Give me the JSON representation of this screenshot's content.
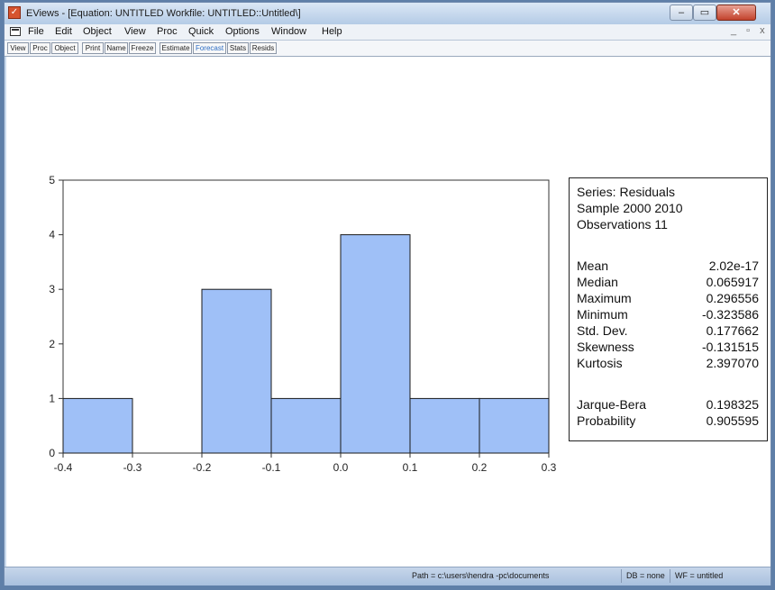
{
  "window": {
    "title": "EViews - [Equation: UNTITLED   Workfile: UNTITLED::Untitled\\]",
    "buttons": {
      "minimize": "–",
      "maximize": "▭",
      "close": "✕"
    }
  },
  "menubar": {
    "items": [
      "File",
      "Edit",
      "Object",
      "View",
      "Proc",
      "Quick",
      "Options",
      "Window",
      "Help"
    ],
    "mdi_controls": "_ ▫ x"
  },
  "toolbar": {
    "buttons": [
      "View",
      "Proc",
      "Object",
      "Print",
      "Name",
      "Freeze",
      "Estimate",
      "Forecast",
      "Stats",
      "Resids"
    ],
    "highlighted": "Forecast"
  },
  "stats": {
    "series": "Series: Residuals",
    "sample": "Sample 2000 2010",
    "observations": "Observations 11",
    "rows": [
      {
        "label": "Mean",
        "value": "2.02e-17"
      },
      {
        "label": "Median",
        "value": "0.065917"
      },
      {
        "label": "Maximum",
        "value": "0.296556"
      },
      {
        "label": "Minimum",
        "value": "-0.323586"
      },
      {
        "label": "Std. Dev.",
        "value": "0.177662"
      },
      {
        "label": "Skewness",
        "value": "-0.131515"
      },
      {
        "label": "Kurtosis",
        "value": "2.397070"
      }
    ],
    "jb_rows": [
      {
        "label": "Jarque-Bera",
        "value": "0.198325"
      },
      {
        "label": "Probability",
        "value": "0.905595"
      }
    ]
  },
  "chart_data": {
    "type": "bar",
    "bins": [
      {
        "from": -0.4,
        "to": -0.3,
        "count": 1
      },
      {
        "from": -0.3,
        "to": -0.2,
        "count": 0
      },
      {
        "from": -0.2,
        "to": -0.1,
        "count": 3
      },
      {
        "from": -0.1,
        "to": 0.0,
        "count": 1
      },
      {
        "from": 0.0,
        "to": 0.1,
        "count": 4
      },
      {
        "from": 0.1,
        "to": 0.2,
        "count": 1
      },
      {
        "from": 0.2,
        "to": 0.3,
        "count": 1
      }
    ],
    "xticks": [
      "-0.4",
      "-0.3",
      "-0.2",
      "-0.1",
      "0.0",
      "0.1",
      "0.2",
      "0.3"
    ],
    "yticks": [
      "0",
      "1",
      "2",
      "3",
      "4",
      "5"
    ],
    "xlim": [
      -0.4,
      0.3
    ],
    "ylim": [
      0,
      5
    ],
    "bar_color": "#9fc0f7",
    "grid": false
  },
  "statusbar": {
    "path": "Path = c:\\users\\hendra -pc\\documents",
    "db": "DB = none",
    "wf": "WF = untitled"
  }
}
